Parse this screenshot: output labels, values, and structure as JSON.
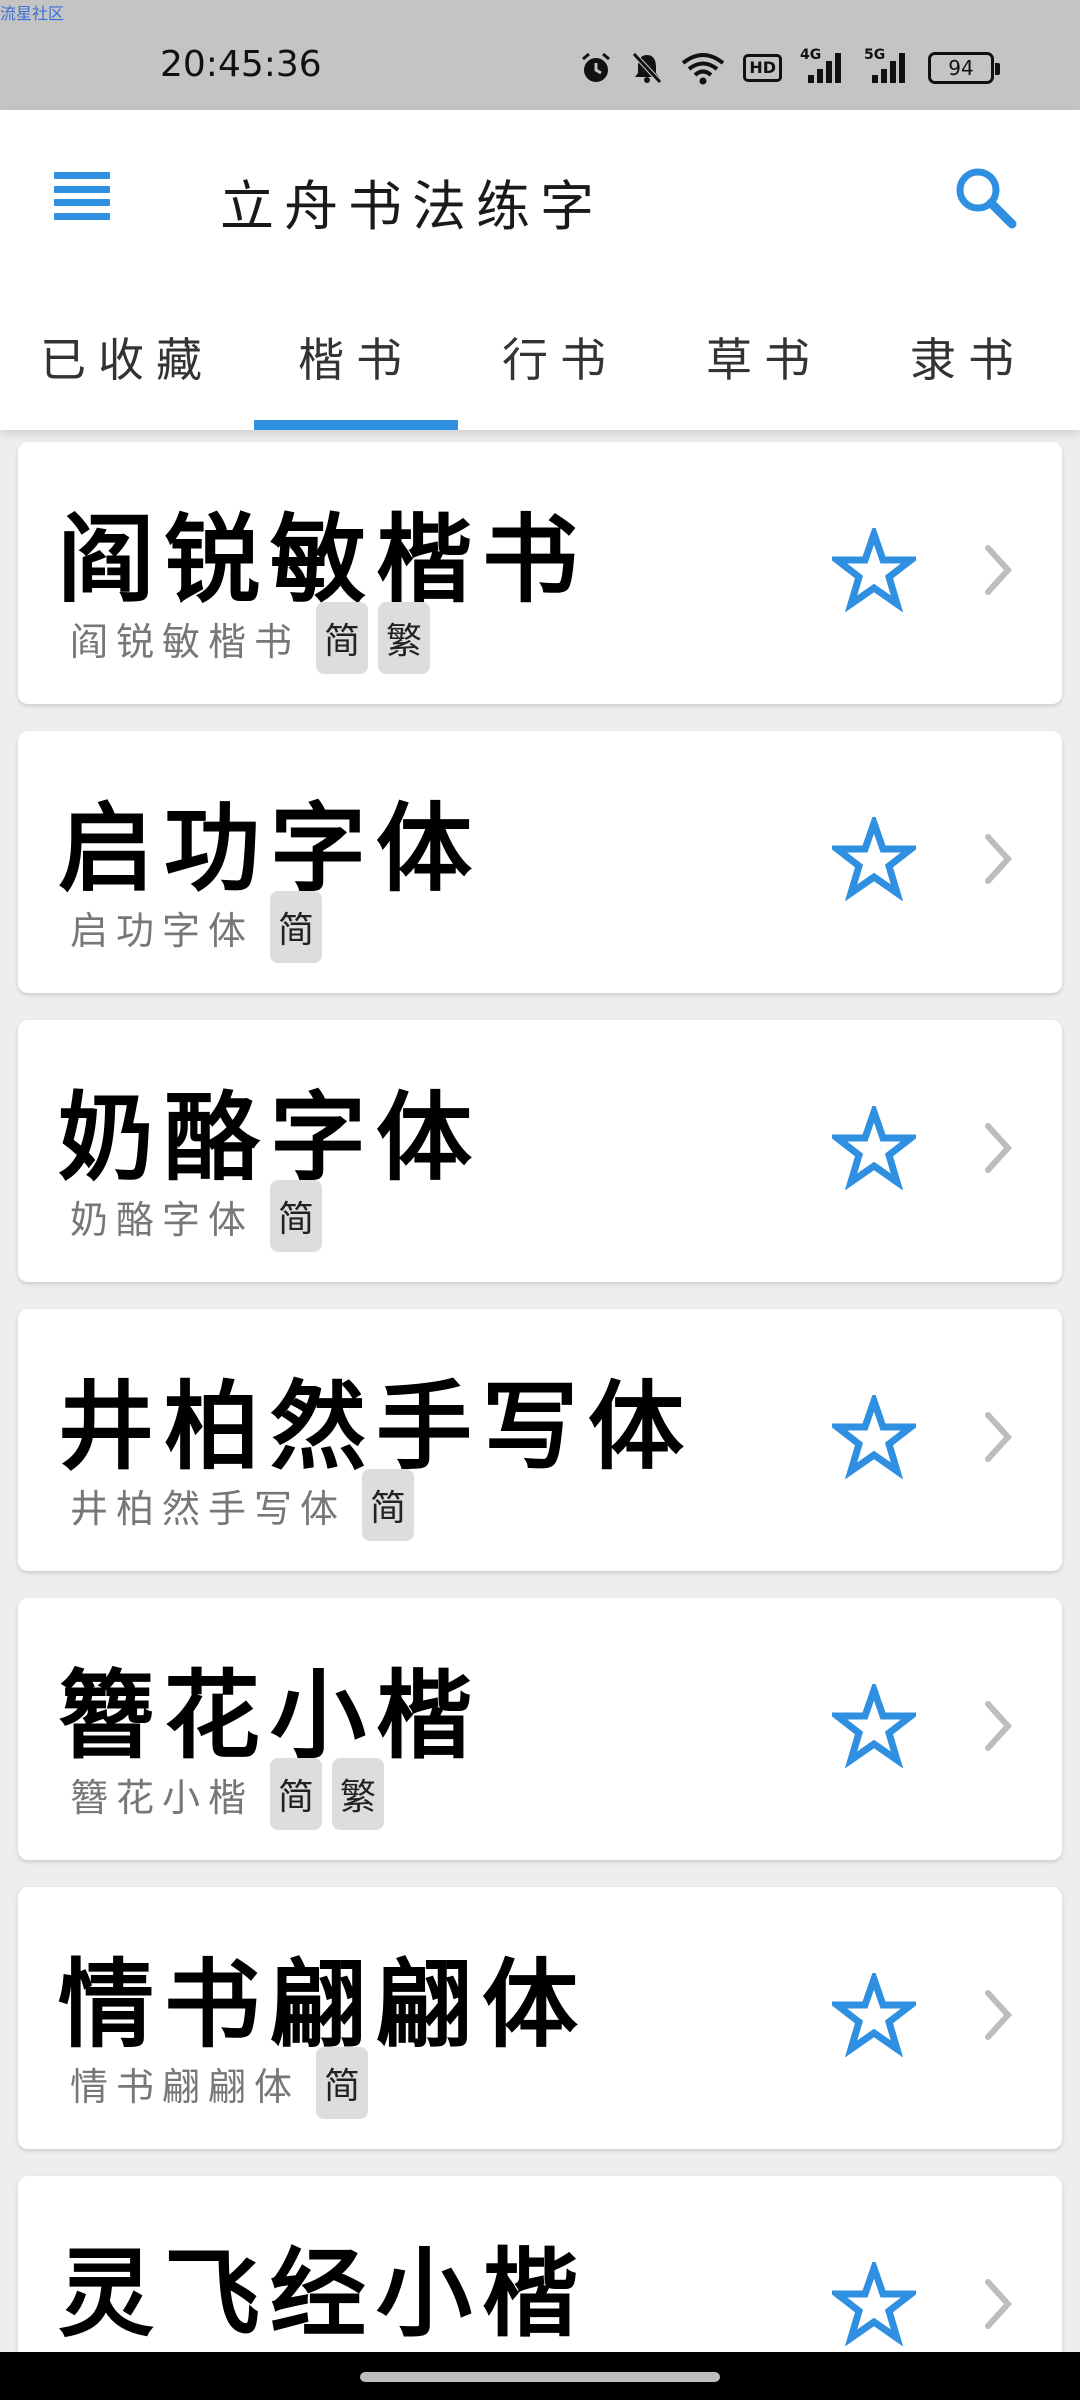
{
  "watermark": "流星社区",
  "status_bar": {
    "time": "20:45:36",
    "hd_label": "HD",
    "net1": "4G",
    "net2": "5G",
    "battery": "94",
    "icons": [
      "alarm-icon",
      "mute-bell-icon",
      "wifi-icon",
      "hd-icon",
      "signal-4g-icon",
      "signal-5g-icon",
      "battery-icon"
    ]
  },
  "app": {
    "title": "立舟书法练字",
    "menu_icon": "hamburger-menu-icon",
    "search_icon": "search-icon",
    "accent": "#2f8fe0"
  },
  "tabs": [
    {
      "label": "已收藏",
      "active": false
    },
    {
      "label": "楷书",
      "active": true
    },
    {
      "label": "行书",
      "active": false
    },
    {
      "label": "草书",
      "active": false
    },
    {
      "label": "隶书",
      "active": false
    }
  ],
  "fonts": [
    {
      "preview": "阎锐敏楷书",
      "name": "阎锐敏楷书",
      "tags": [
        "简",
        "繁"
      ]
    },
    {
      "preview": "启功字体",
      "name": "启功字体",
      "tags": [
        "简"
      ]
    },
    {
      "preview": "奶酪字体",
      "name": "奶酪字体",
      "tags": [
        "简"
      ]
    },
    {
      "preview": "井柏然手写体",
      "name": "井柏然手写体",
      "tags": [
        "简"
      ]
    },
    {
      "preview": "簪花小楷",
      "name": "簪花小楷",
      "tags": [
        "简",
        "繁"
      ]
    },
    {
      "preview": "情书翩翩体",
      "name": "情书翩翩体",
      "tags": [
        "简"
      ]
    },
    {
      "preview": "灵飞经小楷",
      "name": "",
      "tags": []
    }
  ]
}
